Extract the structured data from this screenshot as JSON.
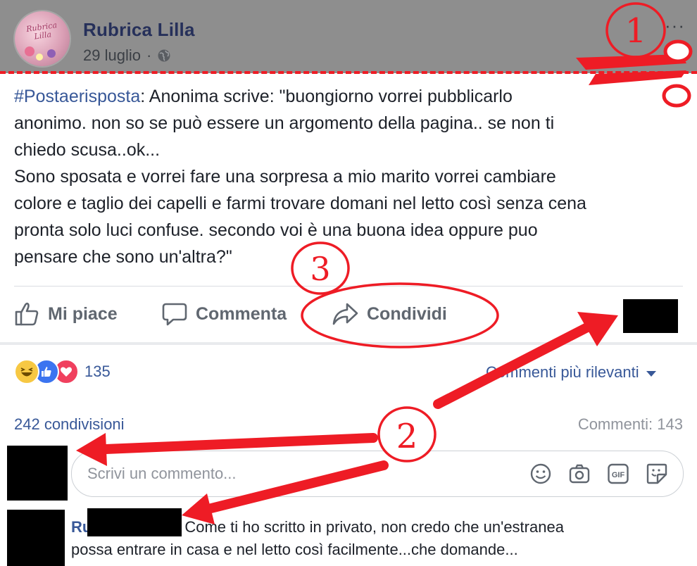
{
  "post": {
    "page_name": "Rubrica Lilla",
    "avatar_text": "Rubrica Lilla",
    "date": "29 luglio",
    "date_separator": "·",
    "more_label": "···",
    "hashtag": "#Postaerisposta",
    "text_line1_rest": ": Anonima scrive: \"buongiorno vorrei pubblicarlo",
    "text_line2": "anonimo. non so se può essere un argomento della pagina.. se non ti",
    "text_line3": "chiedo scusa..ok...",
    "text_line4": "Sono sposata e vorrei fare una sorpresa a mio marito vorrei cambiare",
    "text_line5": "colore e taglio dei capelli e farmi trovare domani nel letto così senza cena",
    "text_line6": "pronta solo luci confuse. secondo voi è una buona idea oppure puo",
    "text_line7": "pensare che sono un'altra?\""
  },
  "actions": {
    "like": "Mi piace",
    "comment": "Commenta",
    "share": "Condividi"
  },
  "stats": {
    "reaction_count": "135",
    "sort_label": "Commenti più rilevanti",
    "shares": "242 condivisioni",
    "comments": "Commenti: 143"
  },
  "composer": {
    "placeholder": "Scrivi un commento..."
  },
  "comment": {
    "name_prefix": "Ru",
    "text_line1": "Come ti ho scritto in privato, non credo che un'estranea",
    "text_line2": "possa entrare in casa e nel letto così facilmente...che domande..."
  },
  "annotations": {
    "n1": "1",
    "n2": "2",
    "n3": "3",
    "color": "#ee1c25"
  },
  "icons": {
    "globe": "globe-icon",
    "like": "thumbs-up-icon",
    "comment": "speech-bubble-icon",
    "share": "share-arrow-icon",
    "emoji": "smiley-icon",
    "camera": "camera-icon",
    "gif": "gif-icon",
    "sticker": "sticker-icon",
    "scissors": "scissors-icon"
  }
}
